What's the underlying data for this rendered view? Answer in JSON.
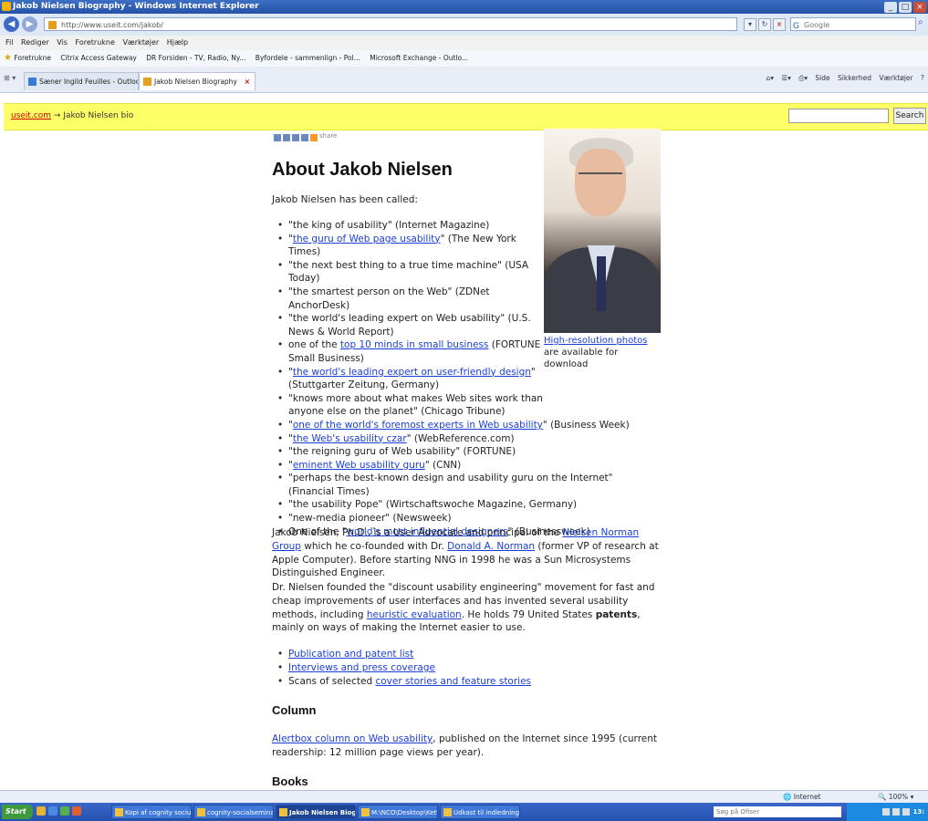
{
  "window": {
    "title": "Jakob Nielsen Biography - Windows Internet Explorer"
  },
  "address_bar": {
    "url": "http://www.useit.com/jakob/",
    "search_placeholder": "Google"
  },
  "menu": [
    "Fil",
    "Rediger",
    "Vis",
    "Foretrukne",
    "Værktøjer",
    "Hjælp"
  ],
  "favorites_bar": {
    "label": "Foretrukne",
    "items": [
      "Citrix Access Gateway",
      "DR Forsiden - TV, Radio, Ny...",
      "Byfordele - sammenlign - Pol...",
      "Microsoft Exchange - Outlo..."
    ]
  },
  "tabs": [
    {
      "label": "Sæner Ingild Feuilles - Outloo..."
    },
    {
      "label": "Jakob Nielsen Biography"
    }
  ],
  "command_bar": [
    "Side",
    "Sikkerhed",
    "Værktøjer"
  ],
  "site_bar": {
    "home_link": "useit.com",
    "arrow": "→",
    "crumb": "Jakob Nielsen bio",
    "search_button": "Search"
  },
  "page": {
    "share_label": "share",
    "title": "About Jakob Nielsen",
    "intro": "Jakob Nielsen has been called:",
    "quotes": [
      {
        "pre": "\"the king of usability\" (Internet Magazine)",
        "link": "",
        "post": ""
      },
      {
        "pre": "\"",
        "link": "the guru of Web page usability",
        "post": "\" (The New York Times)"
      },
      {
        "pre": "\"the next best thing to a true time machine\" (USA Today)",
        "link": "",
        "post": ""
      },
      {
        "pre": "\"the smartest person on the Web\" (ZDNet AnchorDesk)",
        "link": "",
        "post": ""
      },
      {
        "pre": "\"the world's leading expert on Web usability\" (U.S. News & World Report)",
        "link": "",
        "post": ""
      },
      {
        "pre": "one of the ",
        "link": "top 10 minds in small business",
        "post": " (FORTUNE Small Business)"
      },
      {
        "pre": "\"",
        "link": "the world's leading expert on user-friendly design",
        "post": "\" (Stuttgarter Zeitung, Germany)"
      },
      {
        "pre": "\"knows more about what makes Web sites work than anyone else on the planet\" (Chicago Tribune)",
        "link": "",
        "post": ""
      },
      {
        "pre": "\"",
        "link": "one of the world's foremost experts in Web usability",
        "post": "\" (Business Week)"
      },
      {
        "pre": "\"",
        "link": "the Web's usability czar",
        "post": "\" (WebReference.com)"
      },
      {
        "pre": "\"the reigning guru of Web usability\" (FORTUNE)",
        "link": "",
        "post": ""
      },
      {
        "pre": "\"",
        "link": "eminent Web usability guru",
        "post": "\" (CNN)"
      },
      {
        "pre": "\"perhaps the best-known design and usability guru on the Internet\" (Financial Times)",
        "link": "",
        "post": ""
      },
      {
        "pre": "\"the usability Pope\" (Wirtschaftswoche Magazine, Germany)",
        "link": "",
        "post": ""
      },
      {
        "pre": "\"new-media pioneer\" (Newsweek)",
        "link": "",
        "post": ""
      },
      {
        "pre": "One of the \"",
        "link": "world's most influential designers",
        "post": "\" (Businessweek)"
      }
    ],
    "photo_caption_link": "High-resolution photos",
    "photo_caption_rest": " are available for download",
    "bio1": {
      "a": "Jakob Nielsen, Ph.D., is a User Advocate and principal of the ",
      "link1": "Nielsen Norman Group",
      "b": " which he co-founded with Dr. ",
      "link2": "Donald A. Norman",
      "c": " (former VP of research at Apple Computer). Before starting NNG in 1998 he was a Sun Microsystems Distinguished Engineer."
    },
    "bio2": {
      "a": "Dr. Nielsen founded the \"discount usability engineering\" movement for fast and cheap improvements of user interfaces and has invented several usability methods, including ",
      "link": "heuristic evaluation",
      "b": ". He holds 79 United States ",
      "bold": "patents",
      "c": ", mainly on ways of making the Internet easier to use."
    },
    "more_links": [
      {
        "pre": "",
        "link": "Publication and patent list"
      },
      {
        "pre": "",
        "link": "Interviews and press coverage"
      },
      {
        "pre": "Scans of selected ",
        "link": "cover stories and feature stories"
      }
    ],
    "column_heading": "Column",
    "column_text": {
      "link": "Alertbox column on Web usability",
      "rest": ", published on the Internet since 1995 (current readership: 12 million page views per year)."
    },
    "books_heading": "Books"
  },
  "status_bar": {
    "zone": "Internet",
    "zoom": "100%"
  },
  "taskbar": {
    "start": "Start",
    "buttons": [
      "Kopi af cognity sociuso...",
      "cognity-socialsemina.pp...",
      "Jakob Nielsen Biograp...",
      "M:\\NCO\\Desktop\\Ketter ...",
      "Udkast til indledning.mw..."
    ],
    "search_placeholder": "Søg på Ofiser",
    "clock": "13:"
  }
}
